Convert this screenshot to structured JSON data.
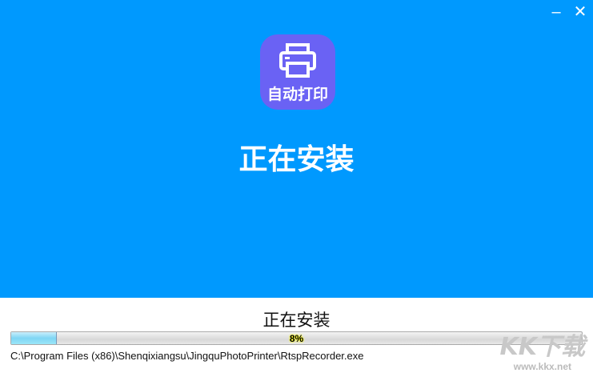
{
  "window": {
    "minimize_icon": "minimize-icon",
    "close_icon": "close-icon"
  },
  "app": {
    "icon_label": "自动打印",
    "icon": "printer-icon",
    "icon_color": "#6a62f4"
  },
  "header": {
    "title": "正在安装",
    "background": "#0099fe"
  },
  "progress": {
    "status": "正在安装",
    "percent": 8,
    "percent_label": "8%",
    "current_file": "C:\\Program Files (x86)\\Shenqixiangsu\\JingquPhotoPrinter\\RtspRecorder.exe"
  },
  "watermark": {
    "logo": "KK下载",
    "url": "www.kkx.net"
  }
}
